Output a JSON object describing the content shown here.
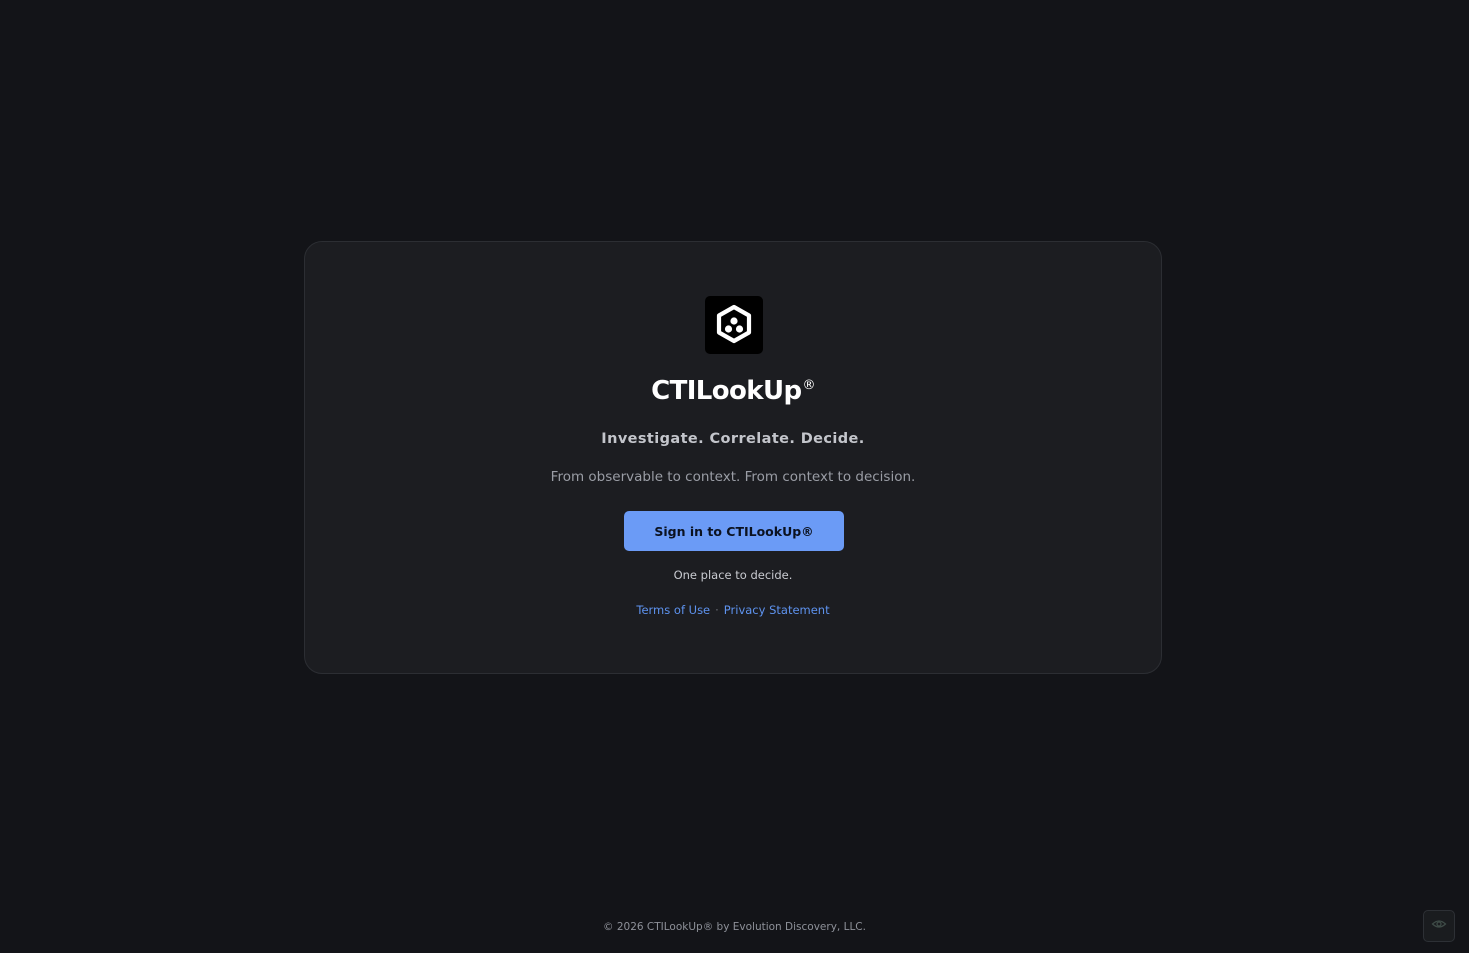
{
  "app": {
    "name": "CTILookUp",
    "registered_mark": "®",
    "tagline": "Investigate. Correlate. Decide.",
    "subtitle": "From observable to context. From context to decision."
  },
  "icons": {
    "logo": "ctilookup-logo-icon",
    "corner": "eye-icon"
  },
  "signin": {
    "label": "Sign in to CTILookUp®"
  },
  "note": "One place to decide.",
  "links": {
    "terms": "Terms of Use",
    "separator": "·",
    "privacy": "Privacy Statement"
  },
  "footer": {
    "text": "© 2026 CTILookUp® by Evolution Discovery, LLC."
  },
  "colors": {
    "background": "#131418",
    "card": "#1c1d21",
    "accent": "#6b9bf6",
    "link": "#5e93ef"
  }
}
